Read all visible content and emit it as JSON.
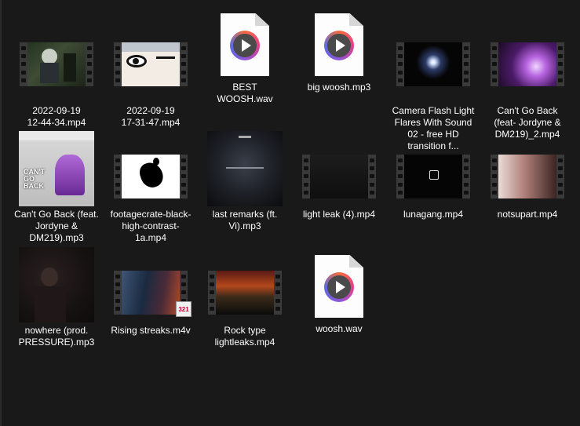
{
  "files": [
    {
      "id": "f1",
      "name": "2022-09-19\n12-44-34.mp4",
      "kind": "video",
      "icon": "video-thumbnail-icon"
    },
    {
      "id": "f2",
      "name": "2022-09-19\n17-31-47.mp4",
      "kind": "video",
      "icon": "video-thumbnail-icon"
    },
    {
      "id": "f3",
      "name": "BEST\nWOOSH.wav",
      "kind": "audio-doc",
      "icon": "media-player-file-icon"
    },
    {
      "id": "f4",
      "name": "big woosh.mp3",
      "kind": "audio-doc",
      "icon": "media-player-file-icon"
    },
    {
      "id": "f5",
      "name": "Camera Flash Light Flares With Sound 02 - free HD transition f...",
      "kind": "video",
      "icon": "video-thumbnail-icon"
    },
    {
      "id": "f6",
      "name": "Can't Go Back (feat- Jordyne & DM219)_2.mp4",
      "kind": "video",
      "icon": "video-thumbnail-icon"
    },
    {
      "id": "f7",
      "name": "Can't Go Back (feat. Jordyne & DM219).mp3",
      "kind": "album",
      "icon": "album-art-icon",
      "art_title": "CAN'T GO BACK"
    },
    {
      "id": "f8",
      "name": "footagecrate-black-high-contrast-1a.mp4",
      "kind": "video",
      "icon": "video-thumbnail-icon"
    },
    {
      "id": "f9",
      "name": "last remarks (ft. Vi).mp3",
      "kind": "album",
      "icon": "album-art-icon"
    },
    {
      "id": "f10",
      "name": "light leak (4).mp4",
      "kind": "video",
      "icon": "video-thumbnail-icon"
    },
    {
      "id": "f11",
      "name": "lunagang.mp4",
      "kind": "video",
      "icon": "video-thumbnail-icon"
    },
    {
      "id": "f12",
      "name": "notsupart.mp4",
      "kind": "video",
      "icon": "video-thumbnail-icon"
    },
    {
      "id": "f13",
      "name": "nowhere (prod. PRESSURE).mp3",
      "kind": "album",
      "icon": "album-art-icon"
    },
    {
      "id": "f14",
      "name": "Rising streaks.m4v",
      "kind": "video",
      "icon": "video-thumbnail-icon",
      "badge": "321"
    },
    {
      "id": "f15",
      "name": "Rock type lightleaks.mp4",
      "kind": "video",
      "icon": "video-thumbnail-icon"
    },
    {
      "id": "f16",
      "name": "woosh.wav",
      "kind": "audio-doc",
      "icon": "media-player-file-icon"
    }
  ],
  "colors": {
    "background": "#191919",
    "text": "#ffffff",
    "film_border": "#3a3a3a"
  }
}
